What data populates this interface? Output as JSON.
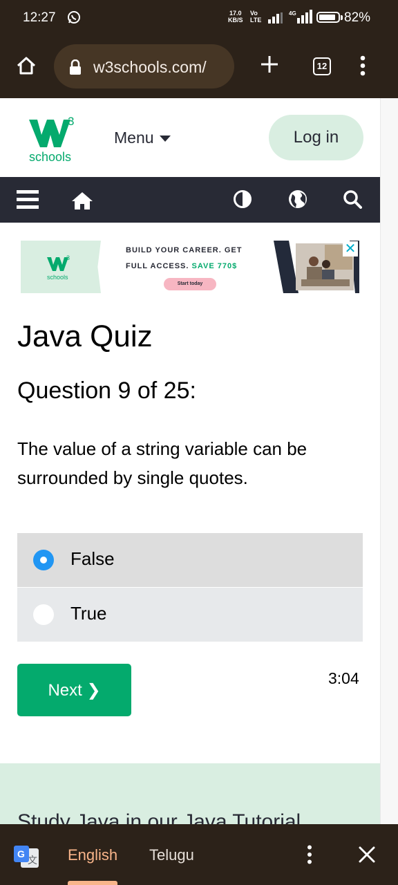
{
  "status_bar": {
    "time": "12:27",
    "net_speed_top": "17.0",
    "net_speed_bottom": "KB/S",
    "volte_top": "Vo",
    "volte_bottom": "LTE",
    "network_type": "4G",
    "battery": "82%"
  },
  "browser": {
    "url": "w3schools.com/",
    "tab_count": "12"
  },
  "header": {
    "logo_text": "schools",
    "logo_sup": "3",
    "menu_label": "Menu",
    "login_label": "Log in"
  },
  "ad": {
    "logo_text": "schools",
    "line1": "BUILD YOUR CAREER. GET",
    "line2_prefix": "FULL ACCESS. ",
    "line2_highlight": "SAVE 770$",
    "cta": "Start today",
    "close": "✕"
  },
  "quiz": {
    "title": "Java Quiz",
    "question_number": "Question 9 of 25:",
    "question_text": "The value of a string variable can be surrounded by single quotes.",
    "options": [
      {
        "label": "False",
        "checked": true
      },
      {
        "label": "True",
        "checked": false
      }
    ],
    "next_label": "Next ❯",
    "timer": "3:04"
  },
  "footer_teaser": {
    "text": "Study Java in our Java Tutorial"
  },
  "translate_bar": {
    "source_lang": "English",
    "target_lang": "Telugu"
  },
  "colors": {
    "brand_green": "#04aa6d",
    "dark_nav": "#282a35",
    "mint": "#d9eee1",
    "radio_blue": "#2196f3",
    "chrome_brown": "#2c2219"
  }
}
